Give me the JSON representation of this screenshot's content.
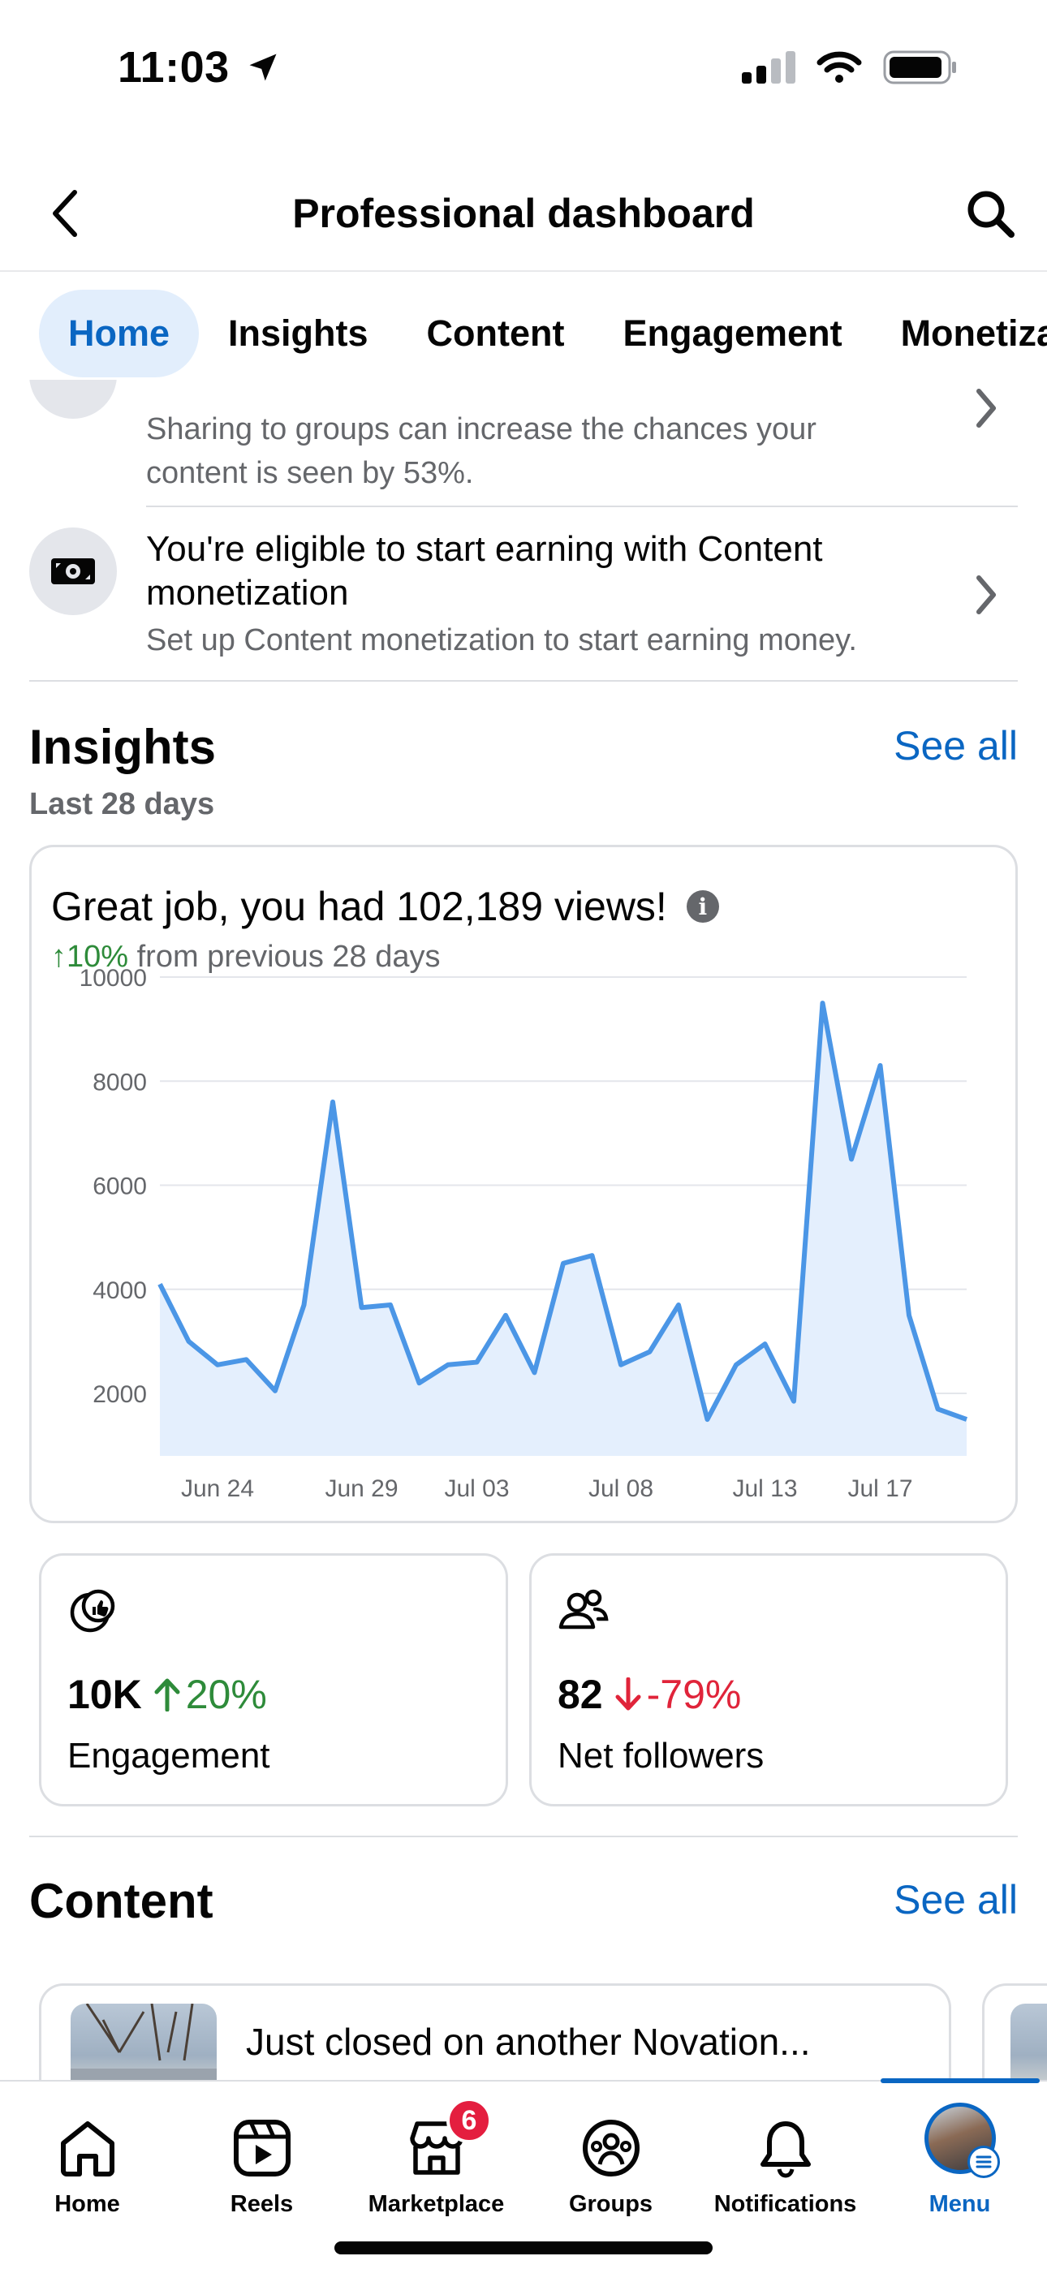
{
  "status_bar": {
    "time": "11:03"
  },
  "header": {
    "title": "Professional dashboard"
  },
  "tabs": [
    {
      "label": "Home",
      "active": true
    },
    {
      "label": "Insights",
      "active": false
    },
    {
      "label": "Content",
      "active": false
    },
    {
      "label": "Engagement",
      "active": false
    },
    {
      "label": "Monetiza",
      "active": false
    }
  ],
  "recommendations": [
    {
      "subtitle": "Sharing to groups can increase the chances your content is seen by 53%."
    },
    {
      "title": "You're eligible to start earning with Content monetization",
      "subtitle": "Set up Content monetization to start earning money."
    }
  ],
  "insights": {
    "title": "Insights",
    "see_all": "See all",
    "period": "Last 28 days",
    "headline": "Great job, you had 102,189 views!",
    "change_value": "↑10%",
    "change_text": "from previous 28 days"
  },
  "chart_data": {
    "type": "area",
    "y_ticks": [
      2000,
      4000,
      6000,
      8000,
      10000
    ],
    "x_tick_labels": [
      "Jun 24",
      "Jun 29",
      "Jul 03",
      "Jul 08",
      "Jul 13",
      "Jul 17"
    ],
    "x": [
      "Jun 22",
      "Jun 23",
      "Jun 24",
      "Jun 25",
      "Jun 26",
      "Jun 27",
      "Jun 28",
      "Jun 29",
      "Jun 30",
      "Jul 01",
      "Jul 02",
      "Jul 03",
      "Jul 04",
      "Jul 05",
      "Jul 06",
      "Jul 07",
      "Jul 08",
      "Jul 09",
      "Jul 10",
      "Jul 11",
      "Jul 12",
      "Jul 13",
      "Jul 14",
      "Jul 15",
      "Jul 16",
      "Jul 17",
      "Jul 18",
      "Jul 19",
      "Jul 20"
    ],
    "values": [
      4100,
      3000,
      2550,
      2650,
      2050,
      3700,
      7600,
      3650,
      3700,
      2200,
      2550,
      2600,
      3500,
      2400,
      4500,
      4650,
      2550,
      2800,
      3700,
      1500,
      2550,
      2950,
      1850,
      9500,
      6500,
      8300,
      3500,
      1700,
      1500
    ],
    "ylim": [
      800,
      10000
    ],
    "grid": true,
    "colors": {
      "line": "#4b96e6",
      "fill": "#e4effd",
      "grid": "#e4e6eb",
      "tick": "#65676b"
    }
  },
  "metrics": [
    {
      "value": "10K",
      "change": "20%",
      "direction": "up",
      "label": "Engagement",
      "icon": "engagement-icon"
    },
    {
      "value": "82",
      "change": "-79%",
      "direction": "down",
      "label": "Net followers",
      "icon": "followers-icon"
    }
  ],
  "content": {
    "title": "Content",
    "see_all": "See all",
    "items": [
      {
        "title": "Just closed on another Novation..."
      }
    ]
  },
  "bottom_nav": [
    {
      "label": "Home",
      "icon": "home-icon"
    },
    {
      "label": "Reels",
      "icon": "reels-icon"
    },
    {
      "label": "Marketplace",
      "icon": "marketplace-icon",
      "badge": "6"
    },
    {
      "label": "Groups",
      "icon": "groups-icon"
    },
    {
      "label": "Notifications",
      "icon": "bell-icon"
    },
    {
      "label": "Menu",
      "icon": "menu-avatar",
      "active": true
    }
  ],
  "colors": {
    "accent": "#0a66c2",
    "up": "#2e8b3a",
    "down": "#e0243a",
    "badge": "#e41e3f"
  }
}
